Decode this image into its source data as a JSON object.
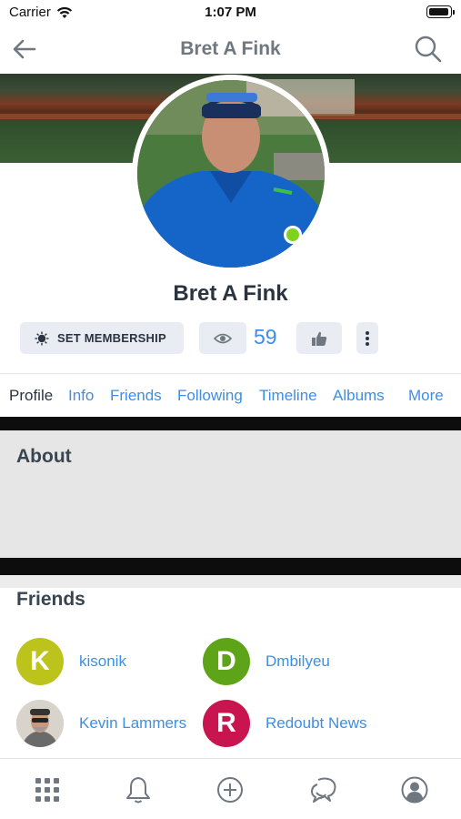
{
  "status_bar": {
    "carrier": "Carrier",
    "time": "1:07 PM"
  },
  "nav": {
    "title": "Bret A Fink",
    "back_icon": "arrow-left-icon",
    "search_icon": "search-icon"
  },
  "profile": {
    "name": "Bret A Fink",
    "online": true,
    "membership_label": "SET MEMBERSHIP",
    "view_count": "59"
  },
  "tabs": [
    {
      "label": "Profile",
      "active": true
    },
    {
      "label": "Info",
      "active": false
    },
    {
      "label": "Friends",
      "active": false
    },
    {
      "label": "Following",
      "active": false
    },
    {
      "label": "Timeline",
      "active": false
    },
    {
      "label": "Albums",
      "active": false
    },
    {
      "label": "More",
      "active": false
    }
  ],
  "about": {
    "title": "About"
  },
  "friends": {
    "title": "Friends",
    "items": [
      {
        "initial": "K",
        "name": "kisonik",
        "color": "#bcc31b"
      },
      {
        "initial": "D",
        "name": "Dmbilyeu",
        "color": "#5da418"
      },
      {
        "initial": "",
        "name": "Kevin Lammers",
        "color": "#8a7a68"
      },
      {
        "initial": "R",
        "name": "Redoubt News",
        "color": "#c8154f"
      }
    ]
  },
  "bottom_bar": {
    "items": [
      "grid-icon",
      "bell-icon",
      "plus-circle-icon",
      "chat-bubbles-icon",
      "account-icon"
    ]
  },
  "colors": {
    "accent": "#3d8ee6",
    "online": "#7ed321",
    "button_bg": "#e9edf3"
  }
}
